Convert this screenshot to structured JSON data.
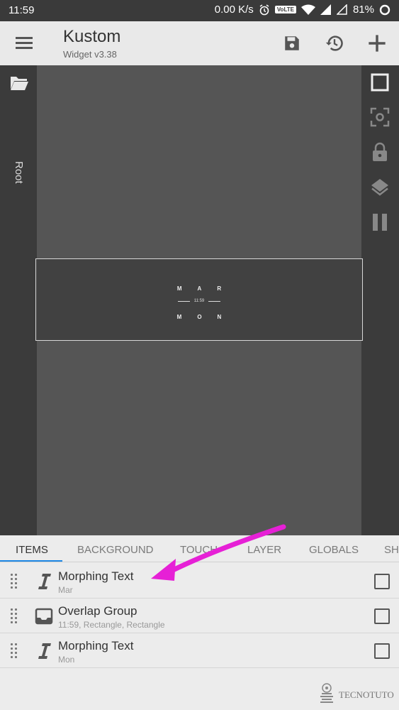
{
  "status_bar": {
    "time": "11:59",
    "net_speed": "0.00 K/s",
    "volte": "VoLTE",
    "battery": "81%"
  },
  "app_bar": {
    "title": "Kustom",
    "subtitle": "Widget v3.38",
    "icons": [
      "menu-icon",
      "save-icon",
      "history-icon",
      "add-icon"
    ]
  },
  "left_rail": {
    "root_label": "Root",
    "icon": "folder-open-icon"
  },
  "right_rail": {
    "icons": [
      "square-icon",
      "focus-icon",
      "lock-icon",
      "layers-icon",
      "pause-icon"
    ]
  },
  "widget_preview": {
    "top_text": "MAR",
    "time": "11:59",
    "bottom_text": "MON"
  },
  "tabs": [
    {
      "label": "ITEMS",
      "active": true
    },
    {
      "label": "BACKGROUND",
      "active": false
    },
    {
      "label": "TOUCH",
      "active": false
    },
    {
      "label": "LAYER",
      "active": false
    },
    {
      "label": "GLOBALS",
      "active": false
    },
    {
      "label": "SH",
      "active": false
    }
  ],
  "items": [
    {
      "title": "Morphing Text",
      "subtitle": "Mar",
      "icon": "text-icon",
      "checked": false
    },
    {
      "title": "Overlap Group",
      "subtitle": "11:59, Rectangle, Rectangle",
      "icon": "overlap-group-icon",
      "checked": false
    },
    {
      "title": "Morphing Text",
      "subtitle": "Mon",
      "icon": "text-icon",
      "checked": false
    }
  ],
  "annotation": {
    "arrow_color": "#e620d6"
  },
  "watermark": {
    "text": "TECNOTUTO"
  },
  "colors": {
    "accent": "#1e88e5",
    "toolbar": "#3b3b3b",
    "canvas": "#555555"
  }
}
